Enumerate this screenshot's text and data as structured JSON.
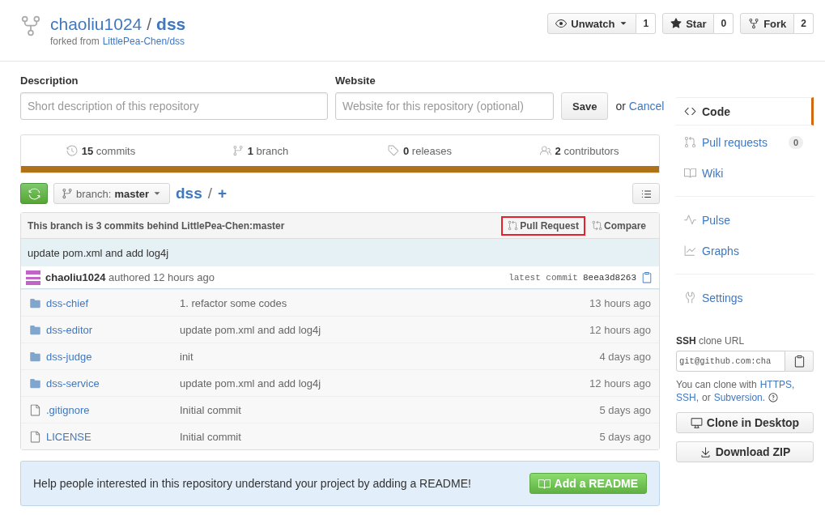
{
  "header": {
    "owner": "chaoliu1024",
    "separator": "/",
    "repo": "dss",
    "forked_from_label": "forked from",
    "forked_from": "LittlePea-Chen/dss",
    "actions": [
      {
        "label": "Unwatch",
        "count": "1",
        "dropdown": true
      },
      {
        "label": "Star",
        "count": "0",
        "dropdown": false
      },
      {
        "label": "Fork",
        "count": "2",
        "dropdown": false
      }
    ]
  },
  "edit_form": {
    "description_label": "Description",
    "description_placeholder": "Short description of this repository",
    "website_label": "Website",
    "website_placeholder": "Website for this repository (optional)",
    "save": "Save",
    "or": "or",
    "cancel": "Cancel"
  },
  "stats": [
    {
      "text": "**15** commits"
    },
    {
      "text": "**1** branch"
    },
    {
      "text": "**0** releases"
    },
    {
      "text": "**2** contributors"
    }
  ],
  "branch_bar": {
    "label": "branch:",
    "branch": "master",
    "path": "dss",
    "separator": "/",
    "add": "+"
  },
  "compare_bar": {
    "message": "This branch is 3 commits behind LittlePea-Chen:master",
    "pull_request": "Pull Request",
    "highlighted": true,
    "compare": "Compare"
  },
  "latest_commit": {
    "message": "update pom.xml and add log4j",
    "author": "**chaoliu1024** authored 12 hours ago",
    "label": "latest commit",
    "sha": "8eea3d8263"
  },
  "files": [
    {
      "kind": "dir",
      "name": "dss-chief",
      "message": "1. refactor some codes",
      "age": "13 hours ago"
    },
    {
      "kind": "dir",
      "name": "dss-editor",
      "message": "update pom.xml and add log4j",
      "age": "12 hours ago"
    },
    {
      "kind": "dir",
      "name": "dss-judge",
      "message": "init",
      "age": "4 days ago"
    },
    {
      "kind": "dir",
      "name": "dss-service",
      "message": "update pom.xml and add log4j",
      "age": "12 hours ago"
    },
    {
      "kind": "file",
      "name": ".gitignore",
      "message": "Initial commit",
      "age": "5 days ago"
    },
    {
      "kind": "file",
      "name": "LICENSE",
      "message": "Initial commit",
      "age": "5 days ago"
    }
  ],
  "readme_prompt": {
    "text": "Help people interested in this repository understand your project by adding a README!",
    "button": "Add a README"
  },
  "sidebar": {
    "groups": [
      [
        {
          "label": "Code",
          "selected": true
        },
        {
          "label": "Pull requests",
          "count": "0",
          "selected": false
        },
        {
          "label": "Wiki",
          "selected": false
        }
      ],
      [
        {
          "label": "Pulse",
          "selected": false
        },
        {
          "label": "Graphs",
          "selected": false
        }
      ],
      [
        {
          "label": "Settings",
          "selected": false
        }
      ]
    ]
  },
  "clone": {
    "heading": "**SSH** clone URL",
    "url": "git@github.com:cha",
    "help": [
      {
        "kind": "text",
        "text": "You can clone with"
      },
      {
        "kind": "link",
        "text": "HTTPS,"
      },
      {
        "kind": "link",
        "text": "SSH,"
      },
      {
        "kind": "text",
        "text": "or"
      },
      {
        "kind": "link",
        "text": "Subversion."
      }
    ],
    "buttons": [
      "Clone in Desktop",
      "Download ZIP"
    ]
  }
}
